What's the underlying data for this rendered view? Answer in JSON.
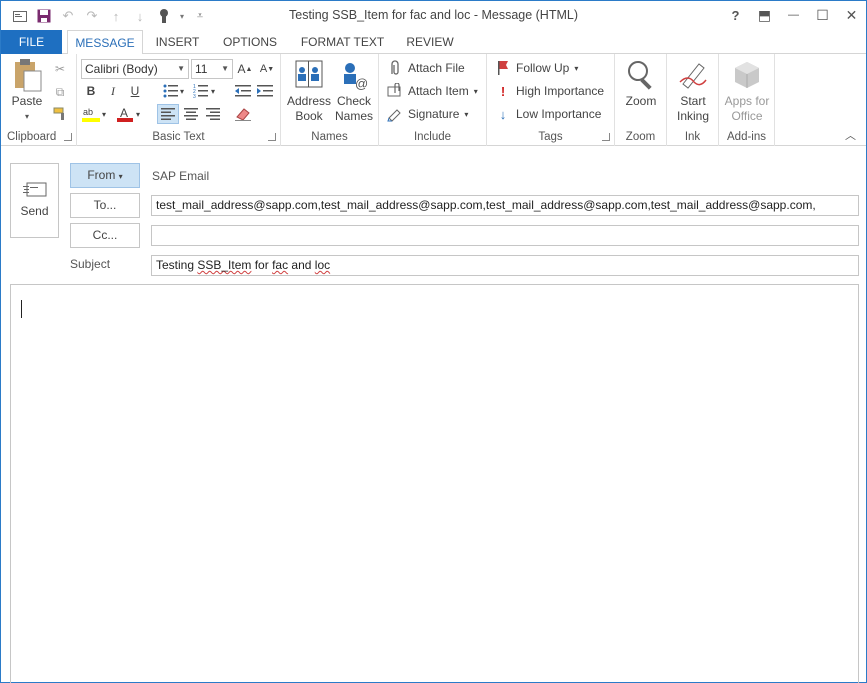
{
  "window": {
    "title": "Testing SSB_Item for fac and loc - Message (HTML)",
    "controls": {
      "help": "?",
      "restore_ribbon": "⬒",
      "minimize": "—",
      "maximize": "☐",
      "close": "✕"
    }
  },
  "qat": {
    "icons": [
      "envelope-icon",
      "save-icon",
      "undo-icon",
      "redo-icon",
      "up-arrow-icon",
      "down-arrow-icon",
      "touch-mode-icon",
      "customize-icon"
    ]
  },
  "tabs": [
    "FILE",
    "MESSAGE",
    "INSERT",
    "OPTIONS",
    "FORMAT TEXT",
    "REVIEW"
  ],
  "ribbon": {
    "clipboard": {
      "label": "Clipboard",
      "paste": "Paste"
    },
    "basic_text": {
      "label": "Basic Text",
      "font": "Calibri (Body)",
      "size": "11",
      "bold": "B",
      "italic": "I",
      "underline": "U"
    },
    "names": {
      "label": "Names",
      "address_book": [
        "Address",
        "Book"
      ],
      "check_names": [
        "Check",
        "Names"
      ]
    },
    "include": {
      "label": "Include",
      "attach_file": "Attach File",
      "attach_item": "Attach Item",
      "signature": "Signature"
    },
    "tags": {
      "label": "Tags",
      "follow_up": "Follow Up",
      "high_importance": "High Importance",
      "low_importance": "Low Importance"
    },
    "zoom": {
      "label": "Zoom",
      "zoom": "Zoom"
    },
    "ink": {
      "label": "Ink",
      "start_inking": [
        "Start",
        "Inking"
      ]
    },
    "addins": {
      "label": "Add-ins",
      "apps": [
        "Apps for",
        "Office"
      ]
    }
  },
  "compose": {
    "send": "Send",
    "from_button": "From",
    "from_value": "SAP Email",
    "to_button": "To...",
    "to_value": "test_mail_address@sapp.com,test_mail_address@sapp.com,test_mail_address@sapp.com,test_mail_address@sapp.com,",
    "cc_button": "Cc...",
    "cc_value": "",
    "subject_label": "Subject",
    "subject_parts": [
      "Testing ",
      "SSB_Item",
      " for ",
      "fac",
      " and ",
      "loc"
    ]
  },
  "colors": {
    "accent": "#1e6fc1",
    "highlight": "#ffff00",
    "font_color": "#d02020",
    "tab_active_text": "#2b6fb8",
    "from_bg": "#cde3f5"
  }
}
